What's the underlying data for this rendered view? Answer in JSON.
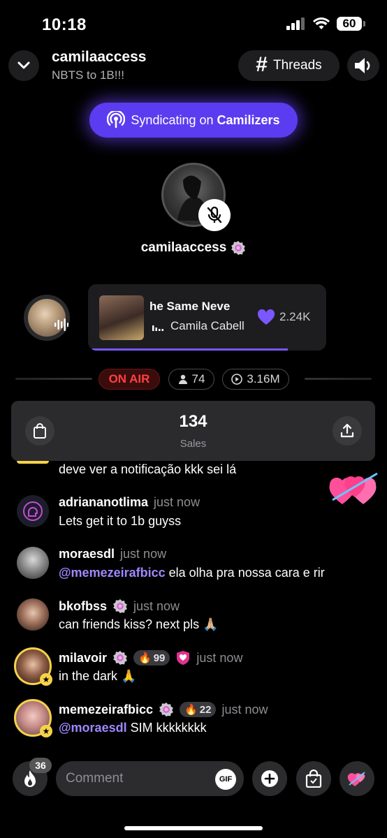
{
  "status_bar": {
    "time": "10:18",
    "battery": "60"
  },
  "header": {
    "host_name": "camilaaccess",
    "space_title": "NBTS to 1B!!!",
    "threads_label": "Threads"
  },
  "sync": {
    "prefix": "Syndicating on ",
    "community": "Camilizers"
  },
  "host": {
    "name": "camilaaccess"
  },
  "music": {
    "title": "he Same    Neve",
    "artist": "Camila Cabell",
    "likes": "2.24K",
    "progress": 0.82
  },
  "live": {
    "on_air": "ON AIR",
    "listeners": "74",
    "plays": "3.16M"
  },
  "sales": {
    "count": "134",
    "label": "Sales"
  },
  "comments": [
    {
      "user": "",
      "time": "",
      "text": "deve ver a notificação kkk sei lá"
    },
    {
      "user": "adriananotlima",
      "time": "just now",
      "text": "Lets get it to 1b guyss"
    },
    {
      "user": "moraesdl",
      "time": "just now",
      "mention": "@memezeirafbicc",
      "text": " ela olha pra nossa cara e rir"
    },
    {
      "user": "bkofbss",
      "time": "just now",
      "text": "can friends kiss? next pls 🙏🏼"
    },
    {
      "user": "milavoir",
      "flame": "99",
      "time": "just now",
      "text": "in the dark 🙏"
    },
    {
      "user": "memezeirafbicc",
      "flame": "22",
      "time": "just now",
      "mention": "@moraesdl",
      "text": " SIM kkkkkkkk"
    }
  ],
  "bottom": {
    "streak": "36",
    "comment_placeholder": "Comment",
    "gif_label": "GIF"
  },
  "colors": {
    "accent": "#5b3cf0",
    "mention": "#9f88ff",
    "on_air": "#ff4141"
  },
  "icons": [
    "chevron-down-icon",
    "hash-icon",
    "speaker-icon",
    "podcast-icon",
    "mic-off-icon",
    "verified-icon",
    "heart-icon",
    "user-icon",
    "play-icon",
    "shopping-bag-icon",
    "share-icon",
    "fire-icon",
    "plus-icon",
    "hearts-icon"
  ]
}
